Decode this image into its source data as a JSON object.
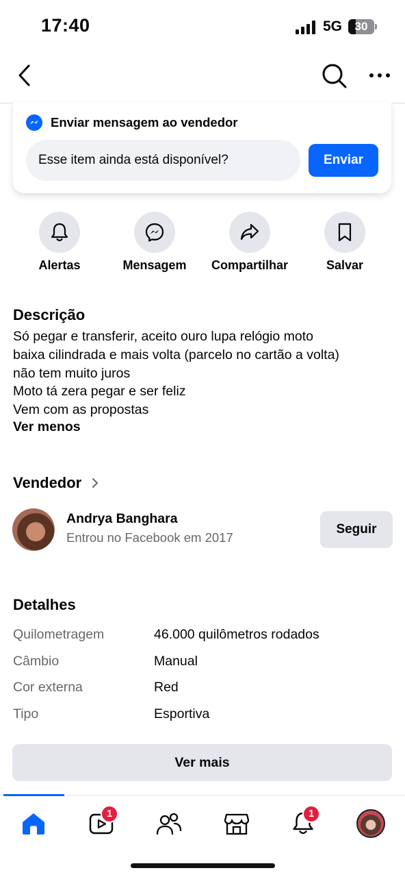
{
  "status_bar": {
    "time": "17:40",
    "network": "5G",
    "battery": "30",
    "battery_level_percent": 30
  },
  "nav": {
    "back_icon": "chevron-left-icon",
    "search_icon": "search-icon",
    "more_icon": "more-horizontal-icon"
  },
  "message_card": {
    "title": "Enviar mensagem ao vendedor",
    "input_value": "Esse item ainda está disponível?",
    "send_label": "Enviar",
    "icon": "messenger-icon",
    "accent": "#0866ff"
  },
  "actions": [
    {
      "label": "Alertas",
      "icon": "bell-icon"
    },
    {
      "label": "Mensagem",
      "icon": "messenger-icon"
    },
    {
      "label": "Compartilhar",
      "icon": "share-icon"
    },
    {
      "label": "Salvar",
      "icon": "bookmark-icon"
    }
  ],
  "description": {
    "title": "Descrição",
    "lines": [
      "Só pegar e transferir, aceito ouro lupa relógio moto",
      "baixa cilindrada e mais volta (parcelo no cartão a volta)",
      "não tem muito juros",
      "Moto tá zera pegar e ser feliz",
      "Vem com as propostas"
    ],
    "toggle_label": "Ver menos"
  },
  "seller": {
    "title": "Vendedor",
    "name": "Andrya Banghara",
    "since": "Entrou no Facebook em 2017",
    "follow_label": "Seguir"
  },
  "details": {
    "title": "Detalhes",
    "rows": [
      {
        "key": "Quilometragem",
        "value": "46.000 quilômetros rodados"
      },
      {
        "key": "Câmbio",
        "value": "Manual"
      },
      {
        "key": "Cor externa",
        "value": "Red"
      },
      {
        "key": "Tipo",
        "value": "Esportiva"
      }
    ],
    "see_more_label": "Ver mais"
  },
  "tab_bar": {
    "tabs": [
      {
        "icon": "home-icon",
        "active": true
      },
      {
        "icon": "video-icon",
        "badge": "1"
      },
      {
        "icon": "friends-icon"
      },
      {
        "icon": "marketplace-icon"
      },
      {
        "icon": "notifications-icon",
        "badge": "1"
      },
      {
        "icon": "profile-avatar"
      }
    ]
  }
}
